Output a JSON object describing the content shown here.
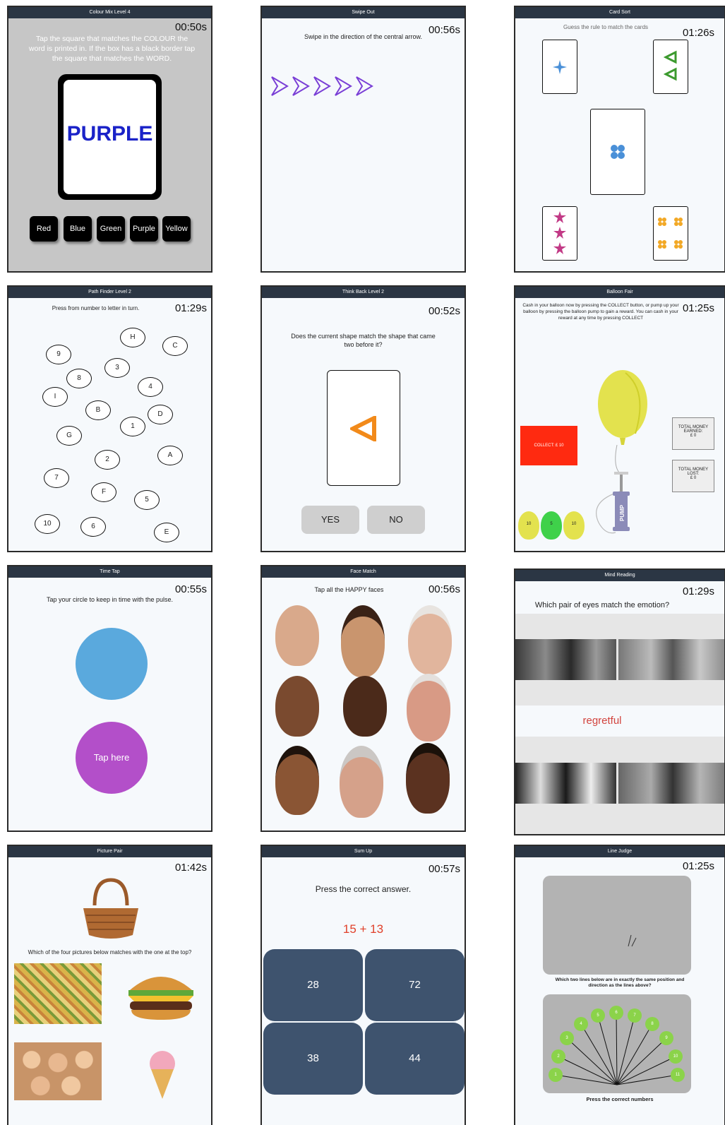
{
  "panels": {
    "colour_mix": {
      "title": "Colour Mix Level 4",
      "timer": "00:50s",
      "instruction": "Tap the square that matches the COLOUR the word is printed in. If the box has a black border tap the square that matches the WORD.",
      "word": "PURPLE",
      "word_color": "#1a22c8",
      "buttons": [
        "Red",
        "Blue",
        "Green",
        "Purple",
        "Yellow"
      ]
    },
    "swipe_out": {
      "title": "Swipe Out",
      "timer": "00:56s",
      "instruction": "Swipe in the direction of the central arrow.",
      "arrow_color": "#7a3fd6"
    },
    "card_sort": {
      "title": "Card Sort",
      "timer": "01:26s",
      "instruction": "Guess the rule to match the cards"
    },
    "path_finder": {
      "title": "Path Finder Level 2",
      "timer": "01:29s",
      "instruction": "Press from number to letter in turn.",
      "nodes": [
        "H",
        "C",
        "9",
        "3",
        "8",
        "4",
        "I",
        "B",
        "D",
        "1",
        "G",
        "A",
        "2",
        "7",
        "F",
        "5",
        "10",
        "6",
        "E"
      ]
    },
    "think_back": {
      "title": "Think Back Level 2",
      "timer": "00:52s",
      "instruction": "Does the current shape match the shape that came two before it?",
      "yes_label": "YES",
      "no_label": "NO"
    },
    "balloon_fair": {
      "title": "Balloon Fair",
      "timer": "01:25s",
      "instruction": "Cash in your balloon now by pressing the COLLECT button, or pump up your balloon by pressing the balloon pump to gain a reward. You can cash in your reward at any time by pressing COLLECT",
      "collect_label": "COLLECT: £ 10",
      "earned_label": "TOTAL MONEY EARNED:",
      "earned_value": "£ 0",
      "lost_label": "TOTAL MONEY LOST:",
      "lost_value": "£ 0",
      "pump_label": "PUMP",
      "small_balloons": [
        "10",
        "5",
        "10"
      ]
    },
    "time_tap": {
      "title": "Time Tap",
      "timer": "00:55s",
      "instruction": "Tap your circle to keep in time with the pulse.",
      "tap_label": "Tap here"
    },
    "face_match": {
      "title": "Face Match",
      "timer": "00:56s",
      "instruction": "Tap all the HAPPY faces"
    },
    "mind_reading": {
      "title": "Mind Reading",
      "timer": "01:29s",
      "instruction": "Which pair of eyes match the emotion?",
      "emotion": "regretful"
    },
    "picture_pair": {
      "title": "Picture Pair",
      "timer": "01:42s",
      "instruction": "Which of the four pictures below matches with the one at the top?"
    },
    "sum_up": {
      "title": "Sum Up",
      "timer": "00:57s",
      "instruction": "Press the correct answer.",
      "equation": "15 + 13",
      "answers": [
        "28",
        "72",
        "38",
        "44"
      ]
    },
    "line_judge": {
      "title": "Line Judge",
      "timer": "01:25s",
      "instruction": "Which two lines below are in exactly the same position and direction as the lines above?",
      "footer": "Press the correct numbers",
      "numbers": [
        "1",
        "2",
        "3",
        "4",
        "5",
        "6",
        "7",
        "8",
        "9",
        "10",
        "11"
      ]
    }
  }
}
